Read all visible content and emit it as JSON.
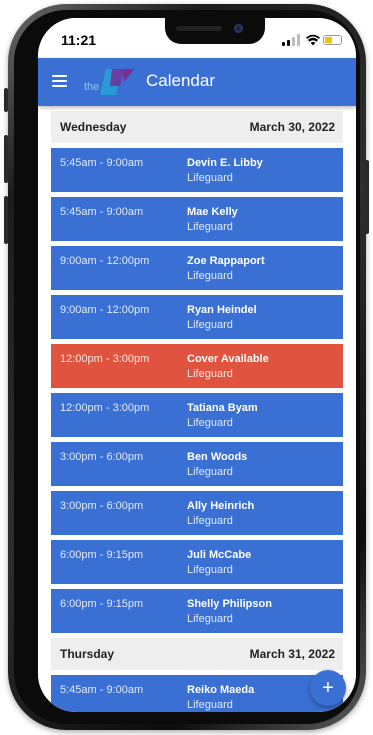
{
  "status_bar": {
    "time": "11:21"
  },
  "app_bar": {
    "title": "Calendar",
    "logo": "the"
  },
  "colors": {
    "primary": "#3a70d4",
    "open_shift": "#e0533f",
    "day_header_bg": "#eeeeee"
  },
  "icons": {
    "menu": "menu-icon",
    "add": "plus-icon",
    "signal": "signal-icon",
    "wifi": "wifi-icon",
    "battery": "battery-icon"
  },
  "days": [
    {
      "name": "Wednesday",
      "date": "March 30, 2022",
      "shifts": [
        {
          "time": "5:45am - 9:00am",
          "name": "Devin E. Libby",
          "role": "Lifeguard",
          "open": false
        },
        {
          "time": "5:45am - 9:00am",
          "name": "Mae Kelly",
          "role": "Lifeguard",
          "open": false
        },
        {
          "time": "9:00am - 12:00pm",
          "name": "Zoe Rappaport",
          "role": "Lifeguard",
          "open": false
        },
        {
          "time": "9:00am - 12:00pm",
          "name": "Ryan Heindel",
          "role": "Lifeguard",
          "open": false
        },
        {
          "time": "12:00pm - 3:00pm",
          "name": "Cover Available",
          "role": "Lifeguard",
          "open": true
        },
        {
          "time": "12:00pm - 3:00pm",
          "name": "Tatiana Byam",
          "role": "Lifeguard",
          "open": false
        },
        {
          "time": "3:00pm - 6:00pm",
          "name": "Ben Woods",
          "role": "Lifeguard",
          "open": false
        },
        {
          "time": "3:00pm - 6:00pm",
          "name": "Ally Heinrich",
          "role": "Lifeguard",
          "open": false
        },
        {
          "time": "6:00pm - 9:15pm",
          "name": "Juli McCabe",
          "role": "Lifeguard",
          "open": false
        },
        {
          "time": "6:00pm - 9:15pm",
          "name": "Shelly Philipson",
          "role": "Lifeguard",
          "open": false
        }
      ]
    },
    {
      "name": "Thursday",
      "date": "March 31, 2022",
      "shifts": [
        {
          "time": "5:45am - 9:00am",
          "name": "Reiko Maeda",
          "role": "Lifeguard",
          "open": false
        }
      ]
    }
  ],
  "fab": {
    "label": "+"
  }
}
